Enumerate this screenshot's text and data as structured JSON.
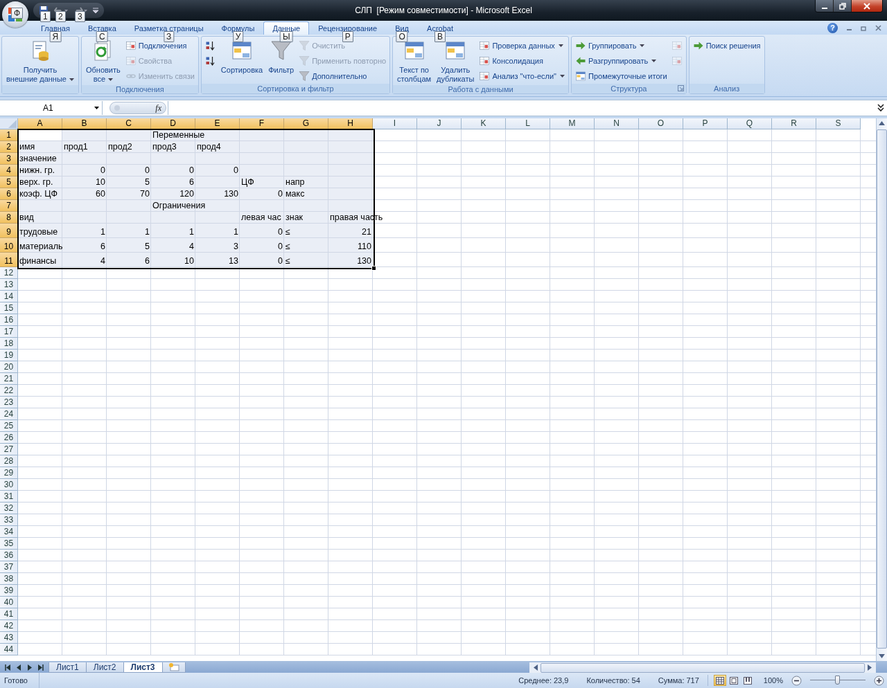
{
  "title_bar": {
    "title": "СЛП  [Режим совместимости] - Microsoft Excel",
    "office_keytip": "Ф",
    "quick_access": [
      {
        "keytip": "1",
        "disabled": false,
        "dropdown": false
      },
      {
        "keytip": "2",
        "disabled": true,
        "dropdown": true
      },
      {
        "keytip": "3",
        "disabled": true,
        "dropdown": true
      }
    ]
  },
  "tabs": [
    {
      "label": "Главная",
      "keytip": "Я",
      "selected": false
    },
    {
      "label": "Вставка",
      "keytip": "С",
      "selected": false
    },
    {
      "label": "Разметка страницы",
      "keytip": "З",
      "selected": false
    },
    {
      "label": "Формулы",
      "keytip": "У",
      "selected": false
    },
    {
      "label": "Данные",
      "keytip": "Ы",
      "selected": true
    },
    {
      "label": "Рецензирование",
      "keytip": "Р",
      "selected": false
    },
    {
      "label": "Вид",
      "keytip": "О",
      "selected": false
    },
    {
      "label": "Acrobat",
      "keytip": "В",
      "selected": false
    }
  ],
  "help": "?",
  "ribbon_groups": [
    {
      "controls": [
        {
          "kind": "large",
          "lines": [
            "Получить",
            "внешние данные"
          ],
          "dropdown": true,
          "disabled": false
        }
      ]
    },
    {
      "title": "Подключения",
      "controls": [
        {
          "kind": "large",
          "lines": [
            "Обновить",
            "все"
          ],
          "dropdown": true,
          "disabled": false
        },
        {
          "kind": "stack",
          "items": [
            {
              "label": "Подключения",
              "disabled": false,
              "dropdown": false
            },
            {
              "label": "Свойства",
              "disabled": true,
              "dropdown": false
            },
            {
              "label": "Изменить связи",
              "disabled": true,
              "dropdown": false
            }
          ]
        }
      ]
    },
    {
      "title": "Сортировка и фильтр",
      "controls": [
        {
          "kind": "stack",
          "items": [
            {
              "disabled": false,
              "dropdown": false
            },
            {
              "disabled": false,
              "dropdown": false
            }
          ]
        },
        {
          "kind": "large",
          "lines": [
            "Сортировка"
          ],
          "dropdown": false,
          "disabled": false
        },
        {
          "kind": "large",
          "lines": [
            "Фильтр"
          ],
          "dropdown": false,
          "disabled": false
        },
        {
          "kind": "stack",
          "items": [
            {
              "label": "Очистить",
              "disabled": true,
              "dropdown": false
            },
            {
              "label": "Применить повторно",
              "disabled": true,
              "dropdown": false
            },
            {
              "label": "Дополнительно",
              "disabled": false,
              "dropdown": false
            }
          ]
        }
      ]
    },
    {
      "title": "Работа с данными",
      "controls": [
        {
          "kind": "large",
          "lines": [
            "Текст по",
            "столбцам"
          ],
          "dropdown": false,
          "disabled": false
        },
        {
          "kind": "large",
          "lines": [
            "Удалить",
            "дубликаты"
          ],
          "dropdown": false,
          "disabled": false
        },
        {
          "kind": "stack",
          "items": [
            {
              "label": "Проверка данных",
              "disabled": false,
              "dropdown": true
            },
            {
              "label": "Консолидация",
              "disabled": false,
              "dropdown": false
            },
            {
              "label": "Анализ \"что-если\"",
              "disabled": false,
              "dropdown": true
            }
          ]
        }
      ]
    },
    {
      "title": "Структура",
      "launcher": true,
      "controls": [
        {
          "kind": "stack",
          "items": [
            {
              "label": "Группировать",
              "disabled": false,
              "dropdown": true
            },
            {
              "label": "Разгруппировать",
              "disabled": false,
              "dropdown": true
            },
            {
              "label": "Промежуточные итоги",
              "disabled": false,
              "dropdown": false
            }
          ]
        },
        {
          "kind": "stack",
          "items": [
            {
              "disabled": true,
              "dropdown": false
            },
            {
              "disabled": true,
              "dropdown": false
            }
          ]
        }
      ]
    },
    {
      "title": "Анализ",
      "controls": [
        {
          "kind": "stack",
          "items": [
            {
              "label": "Поиск решения",
              "disabled": false,
              "dropdown": false
            }
          ]
        }
      ]
    }
  ],
  "formula_bar": {
    "name_box": "A1",
    "function_label": "fx"
  },
  "columns": [
    {
      "label": "A",
      "selected": true,
      "active": true
    },
    {
      "label": "B",
      "selected": true
    },
    {
      "label": "C",
      "selected": true
    },
    {
      "label": "D",
      "selected": true
    },
    {
      "label": "E",
      "selected": true
    },
    {
      "label": "F",
      "selected": true
    },
    {
      "label": "G",
      "selected": true
    },
    {
      "label": "H",
      "selected": true
    },
    {
      "label": "I",
      "selected": false
    },
    {
      "label": "J",
      "selected": false
    },
    {
      "label": "K",
      "selected": false
    },
    {
      "label": "L",
      "selected": false
    },
    {
      "label": "M",
      "selected": false
    },
    {
      "label": "N",
      "selected": false
    },
    {
      "label": "O",
      "selected": false
    },
    {
      "label": "P",
      "selected": false
    },
    {
      "label": "Q",
      "selected": false
    },
    {
      "label": "R",
      "selected": false
    },
    {
      "label": "S",
      "selected": false
    }
  ],
  "rows": [
    {
      "number": "1",
      "selected": true,
      "active": true,
      "cells": [
        null,
        null,
        null,
        "Переменные",
        null,
        null,
        null,
        null
      ]
    },
    {
      "number": "2",
      "selected": true,
      "cells": [
        "имя",
        "прод1",
        "прод2",
        "прод3",
        "прод4",
        null,
        null,
        null
      ]
    },
    {
      "number": "3",
      "selected": true,
      "cells": [
        "значение",
        null,
        null,
        null,
        null,
        null,
        null,
        null
      ]
    },
    {
      "number": "4",
      "selected": true,
      "cells": [
        "нижн. гр.",
        "0",
        "0",
        "0",
        "0",
        null,
        null,
        null
      ]
    },
    {
      "number": "5",
      "selected": true,
      "cells": [
        "верх. гр.",
        "10",
        "5",
        "6",
        null,
        "ЦФ",
        "напр",
        null
      ]
    },
    {
      "number": "6",
      "selected": true,
      "cells": [
        "коэф. ЦФ",
        "60",
        "70",
        "120",
        "130",
        "0",
        "макс",
        null
      ]
    },
    {
      "number": "7",
      "selected": true,
      "cells": [
        null,
        null,
        null,
        "Ограничения",
        null,
        null,
        null,
        null
      ]
    },
    {
      "number": "8",
      "selected": true,
      "cells": [
        "вид",
        null,
        null,
        null,
        null,
        "левая час",
        "знак",
        "правая часть"
      ]
    },
    {
      "number": "9",
      "selected": true,
      "tall": true,
      "cells": [
        "трудовые",
        "1",
        "1",
        "1",
        "1",
        "0",
        "≤",
        "21"
      ]
    },
    {
      "number": "10",
      "selected": true,
      "tall": true,
      "cells": [
        "материаль",
        "6",
        "5",
        "4",
        "3",
        "0",
        "≤",
        "110"
      ]
    },
    {
      "number": "11",
      "selected": true,
      "tall": true,
      "cells": [
        "финансы",
        "4",
        "6",
        "10",
        "13",
        "0",
        "≤",
        "130"
      ]
    },
    {
      "number": "12",
      "selected": false
    },
    {
      "number": "13",
      "selected": false
    },
    {
      "number": "14",
      "selected": false
    },
    {
      "number": "15",
      "selected": false
    },
    {
      "number": "16",
      "selected": false
    },
    {
      "number": "17",
      "selected": false
    },
    {
      "number": "18",
      "selected": false
    },
    {
      "number": "19",
      "selected": false
    },
    {
      "number": "20",
      "selected": false
    },
    {
      "number": "21",
      "selected": false
    },
    {
      "number": "22",
      "selected": false
    },
    {
      "number": "23",
      "selected": false
    },
    {
      "number": "24",
      "selected": false
    },
    {
      "number": "25",
      "selected": false
    },
    {
      "number": "26",
      "selected": false
    },
    {
      "number": "27",
      "selected": false
    },
    {
      "number": "28",
      "selected": false
    },
    {
      "number": "29",
      "selected": false
    },
    {
      "number": "30",
      "selected": false
    },
    {
      "number": "31",
      "selected": false
    },
    {
      "number": "32",
      "selected": false
    },
    {
      "number": "33",
      "selected": false
    },
    {
      "number": "34",
      "selected": false
    },
    {
      "number": "35",
      "selected": false
    },
    {
      "number": "36",
      "selected": false
    },
    {
      "number": "37",
      "selected": false
    },
    {
      "number": "38",
      "selected": false
    },
    {
      "number": "39",
      "selected": false
    },
    {
      "number": "40",
      "selected": false
    },
    {
      "number": "41",
      "selected": false
    },
    {
      "number": "42",
      "selected": false
    },
    {
      "number": "43",
      "selected": false
    },
    {
      "number": "44",
      "selected": false
    }
  ],
  "sheet_tabs": [
    {
      "label": "Лист1",
      "selected": false
    },
    {
      "label": "Лист2",
      "selected": false
    },
    {
      "label": "Лист3",
      "selected": true
    }
  ],
  "status_bar": {
    "mode": "Готово",
    "stats": [
      "Среднее: 23,9",
      "Количество: 54",
      "Сумма: 717"
    ],
    "views": [
      {
        "selected": true
      },
      {
        "selected": false
      },
      {
        "selected": false
      }
    ],
    "zoom": "100%",
    "zoom_slider": {
      "level": 0.5
    }
  }
}
